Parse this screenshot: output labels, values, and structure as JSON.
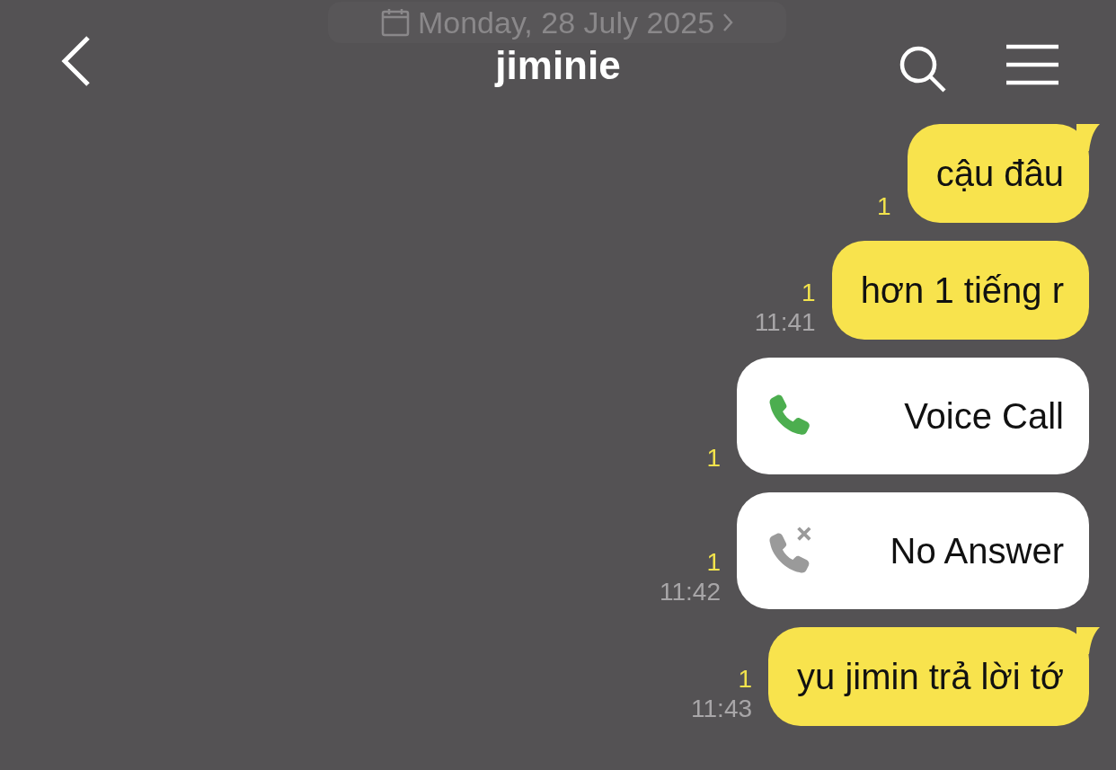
{
  "header": {
    "title": "jiminie",
    "date_banner": "Monday, 28 July 2025"
  },
  "messages": [
    {
      "kind": "text",
      "text": "cậu đâu",
      "unread": "1",
      "tail": true
    },
    {
      "kind": "text",
      "text": "hơn 1 tiếng r",
      "unread": "1",
      "time": "11:41",
      "tail": false
    },
    {
      "kind": "voice_call",
      "text": "Voice Call",
      "unread": "1"
    },
    {
      "kind": "missed_call",
      "text": "No Answer",
      "unread": "1",
      "time": "11:42"
    },
    {
      "kind": "text",
      "text": "yu jimin trả lời tớ",
      "unread": "1",
      "time": "11:43",
      "tail": true
    }
  ]
}
